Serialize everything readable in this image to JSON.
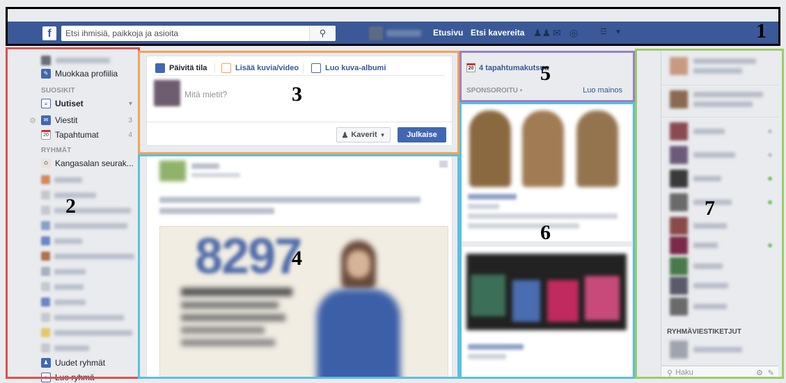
{
  "topbar": {
    "logo": "f",
    "search_placeholder": "Etsi ihmisiä, paikkoja ja asioita",
    "home_label": "Etusivu",
    "find_friends_label": "Etsi kavereita"
  },
  "sidebar": {
    "edit_profile": "Muokkaa profiilia",
    "favorites_heading": "SUOSIKIT",
    "news": "Uutiset",
    "messages": "Viestit",
    "messages_count": "3",
    "events_icon_text": "20",
    "events": "Tapahtumat",
    "events_count": "4",
    "groups_heading": "RYHMÄT",
    "group_first": "Kangasalan seurak...",
    "new_groups": "Uudet ryhmät",
    "create_group": "Luo ryhmä"
  },
  "composer": {
    "tab_status": "Päivitä tila",
    "tab_photo": "Lisää kuvia/video",
    "tab_album": "Luo kuva-albumi",
    "placeholder": "Mitä mietit?",
    "audience": "Kaverit",
    "publish": "Julkaise"
  },
  "feed": {
    "number_text": "8297"
  },
  "right": {
    "event_icon_text": "20",
    "event_invites": "4 tapahtumakutsua",
    "sponsored": "SPONSOROITU",
    "create_ad": "Luo mainos"
  },
  "chat": {
    "group_conversations": "RYHMÄVIESTIKETJUT",
    "search": "Haku"
  },
  "annotations": [
    "1",
    "2",
    "3",
    "4",
    "5",
    "6",
    "7"
  ],
  "colors": {
    "brand": "#3b5998",
    "box1": "#000000",
    "box2": "#d9534f",
    "box3": "#f0a35a",
    "box4": "#5bc0de",
    "box5": "#9b7fc4",
    "box6": "#5bc0de",
    "box7": "#9ccc65"
  }
}
